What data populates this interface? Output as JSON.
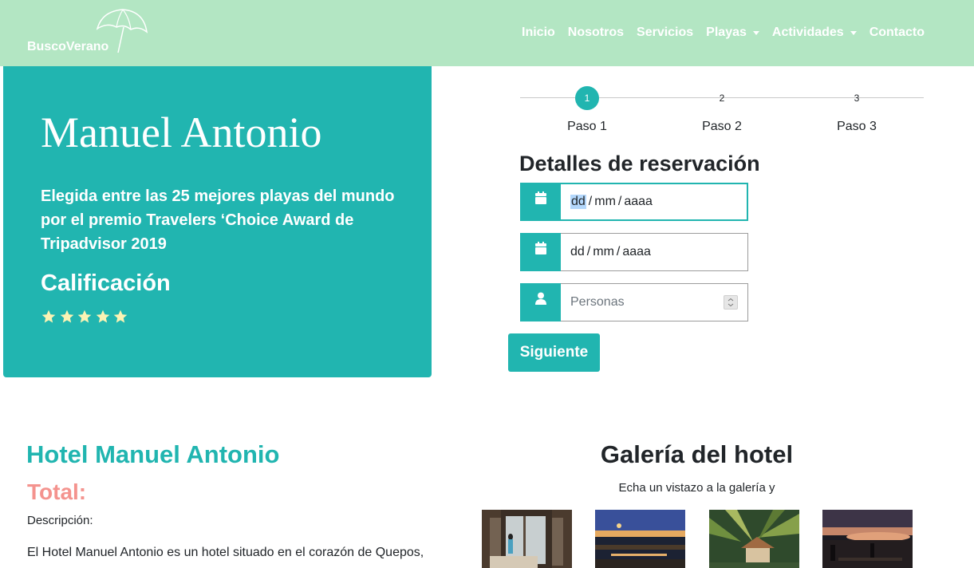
{
  "navbar": {
    "brand": "BuscoVerano",
    "brand_logo_icon": "beach-umbrella-icon",
    "items": [
      {
        "label": "Inicio",
        "dropdown": false
      },
      {
        "label": "Nosotros",
        "dropdown": false
      },
      {
        "label": "Servicios",
        "dropdown": false
      },
      {
        "label": "Playas",
        "dropdown": true
      },
      {
        "label": "Actividades",
        "dropdown": true
      },
      {
        "label": "Contacto",
        "dropdown": false
      }
    ],
    "bg_color": "#b3e6c3"
  },
  "hero": {
    "title": "Manuel Antonio",
    "description": "Elegida entre las 25 mejores playas del mundo por el premio Travelers ‘Choice Award de Tripadvisor 2019",
    "rating_title": "Calificación",
    "rating": 5,
    "rating_max": 5,
    "bg_color": "#21b5b0",
    "star_color": "#fbf3b4"
  },
  "stepper": {
    "steps": [
      {
        "number": "1",
        "label": "Paso 1",
        "active": true
      },
      {
        "number": "2",
        "label": "Paso 2",
        "active": false
      },
      {
        "number": "3",
        "label": "Paso 3",
        "active": false
      }
    ]
  },
  "form": {
    "title": "Detalles de reservación",
    "date_in": {
      "icon": "calendar-icon",
      "dd": "dd",
      "mm": "mm",
      "yyyy": "aaaa",
      "sep": "/"
    },
    "date_out": {
      "icon": "calendar-icon",
      "dd": "dd",
      "mm": "mm",
      "yyyy": "aaaa",
      "sep": "/"
    },
    "people": {
      "icon": "user-icon",
      "placeholder": "Personas"
    },
    "next_label": "Siguiente"
  },
  "hotel": {
    "title": "Hotel Manuel Antonio",
    "total_label": "Total:",
    "description_label": "Descripción:",
    "description": "El Hotel Manuel Antonio es un hotel situado en el corazón de Quepos,"
  },
  "gallery": {
    "title": "Galería del hotel",
    "subtitle": "Echa un vistazo a la galería y",
    "images": [
      "hotel-room-photo",
      "hotel-terrace-dusk-photo",
      "palm-bungalow-photo",
      "sunset-restaurant-photo"
    ]
  },
  "colors": {
    "accent": "#21b5b0",
    "total": "#f4938e"
  }
}
